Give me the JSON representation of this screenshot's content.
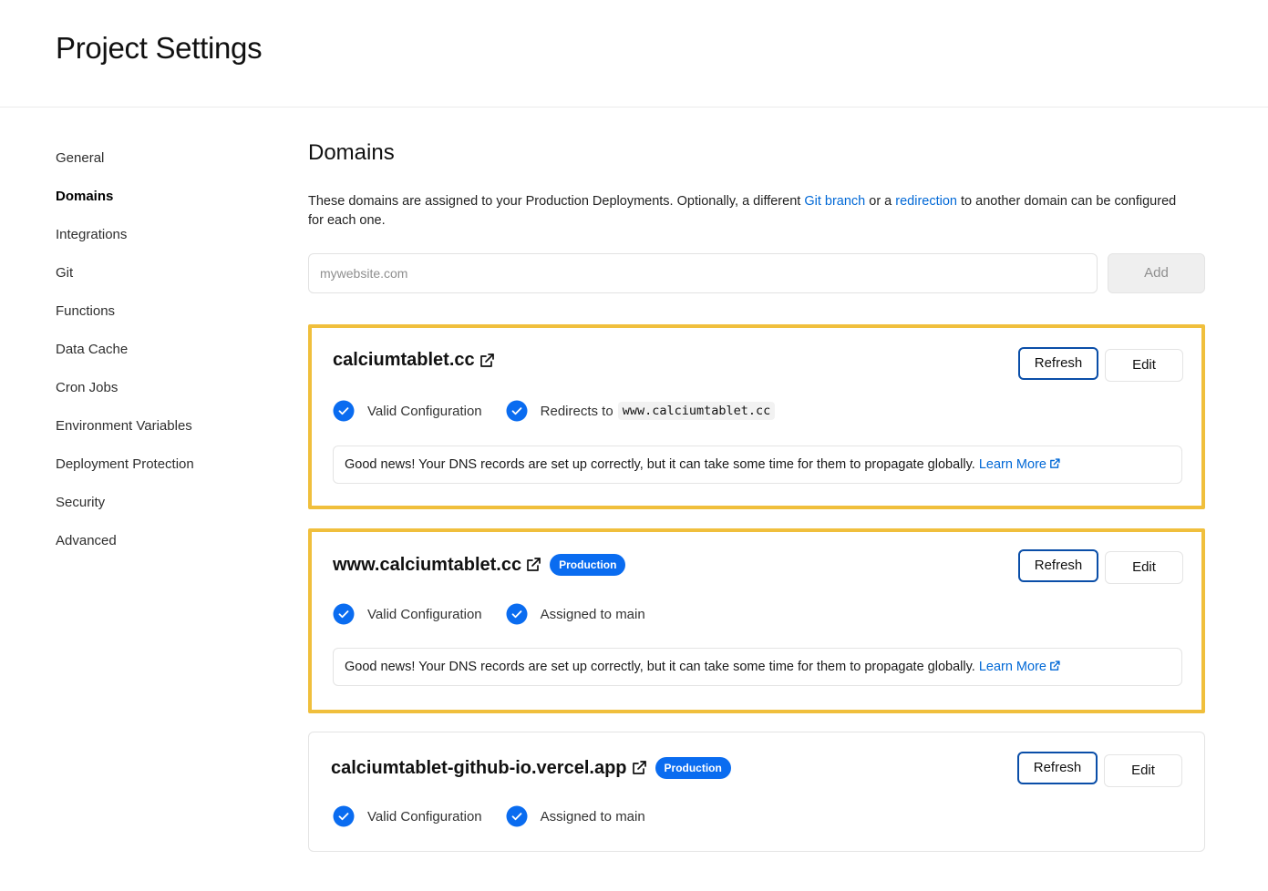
{
  "header": {
    "title": "Project Settings"
  },
  "sidebar": {
    "items": [
      {
        "label": "General"
      },
      {
        "label": "Domains"
      },
      {
        "label": "Integrations"
      },
      {
        "label": "Git"
      },
      {
        "label": "Functions"
      },
      {
        "label": "Data Cache"
      },
      {
        "label": "Cron Jobs"
      },
      {
        "label": "Environment Variables"
      },
      {
        "label": "Deployment Protection"
      },
      {
        "label": "Security"
      },
      {
        "label": "Advanced"
      }
    ]
  },
  "main": {
    "title": "Domains",
    "description": {
      "part1": "These domains are assigned to your Production Deployments. Optionally, a different ",
      "git_branch_link": "Git branch",
      "part2": " or a ",
      "redirection_link": "redirection",
      "part3": " to another domain can be configured for each one."
    },
    "add_form": {
      "placeholder": "mywebsite.com",
      "button_label": "Add"
    },
    "domains": [
      {
        "name": "calciumtablet.cc",
        "status_valid": "Valid Configuration",
        "status_secondary": "Redirects to",
        "redirect_target": "www.calciumtablet.cc",
        "notice_text": "Good news! Your DNS records are set up correctly, but it can take some time for them to propagate globally.",
        "notice_link": "Learn More",
        "refresh_label": "Refresh",
        "edit_label": "Edit"
      },
      {
        "name": "www.calciumtablet.cc",
        "badge": "Production",
        "status_valid": "Valid Configuration",
        "status_secondary": "Assigned to main",
        "notice_text": "Good news! Your DNS records are set up correctly, but it can take some time for them to propagate globally.",
        "notice_link": "Learn More",
        "refresh_label": "Refresh",
        "edit_label": "Edit"
      },
      {
        "name": "calciumtablet-github-io.vercel.app",
        "badge": "Production",
        "status_valid": "Valid Configuration",
        "status_secondary": "Assigned to main",
        "refresh_label": "Refresh",
        "edit_label": "Edit"
      }
    ]
  },
  "colors": {
    "accent_blue": "#0a6cf0",
    "link_blue": "#0068d6",
    "highlight": "#f0bf3c",
    "refresh_border": "#0a4ea8"
  }
}
